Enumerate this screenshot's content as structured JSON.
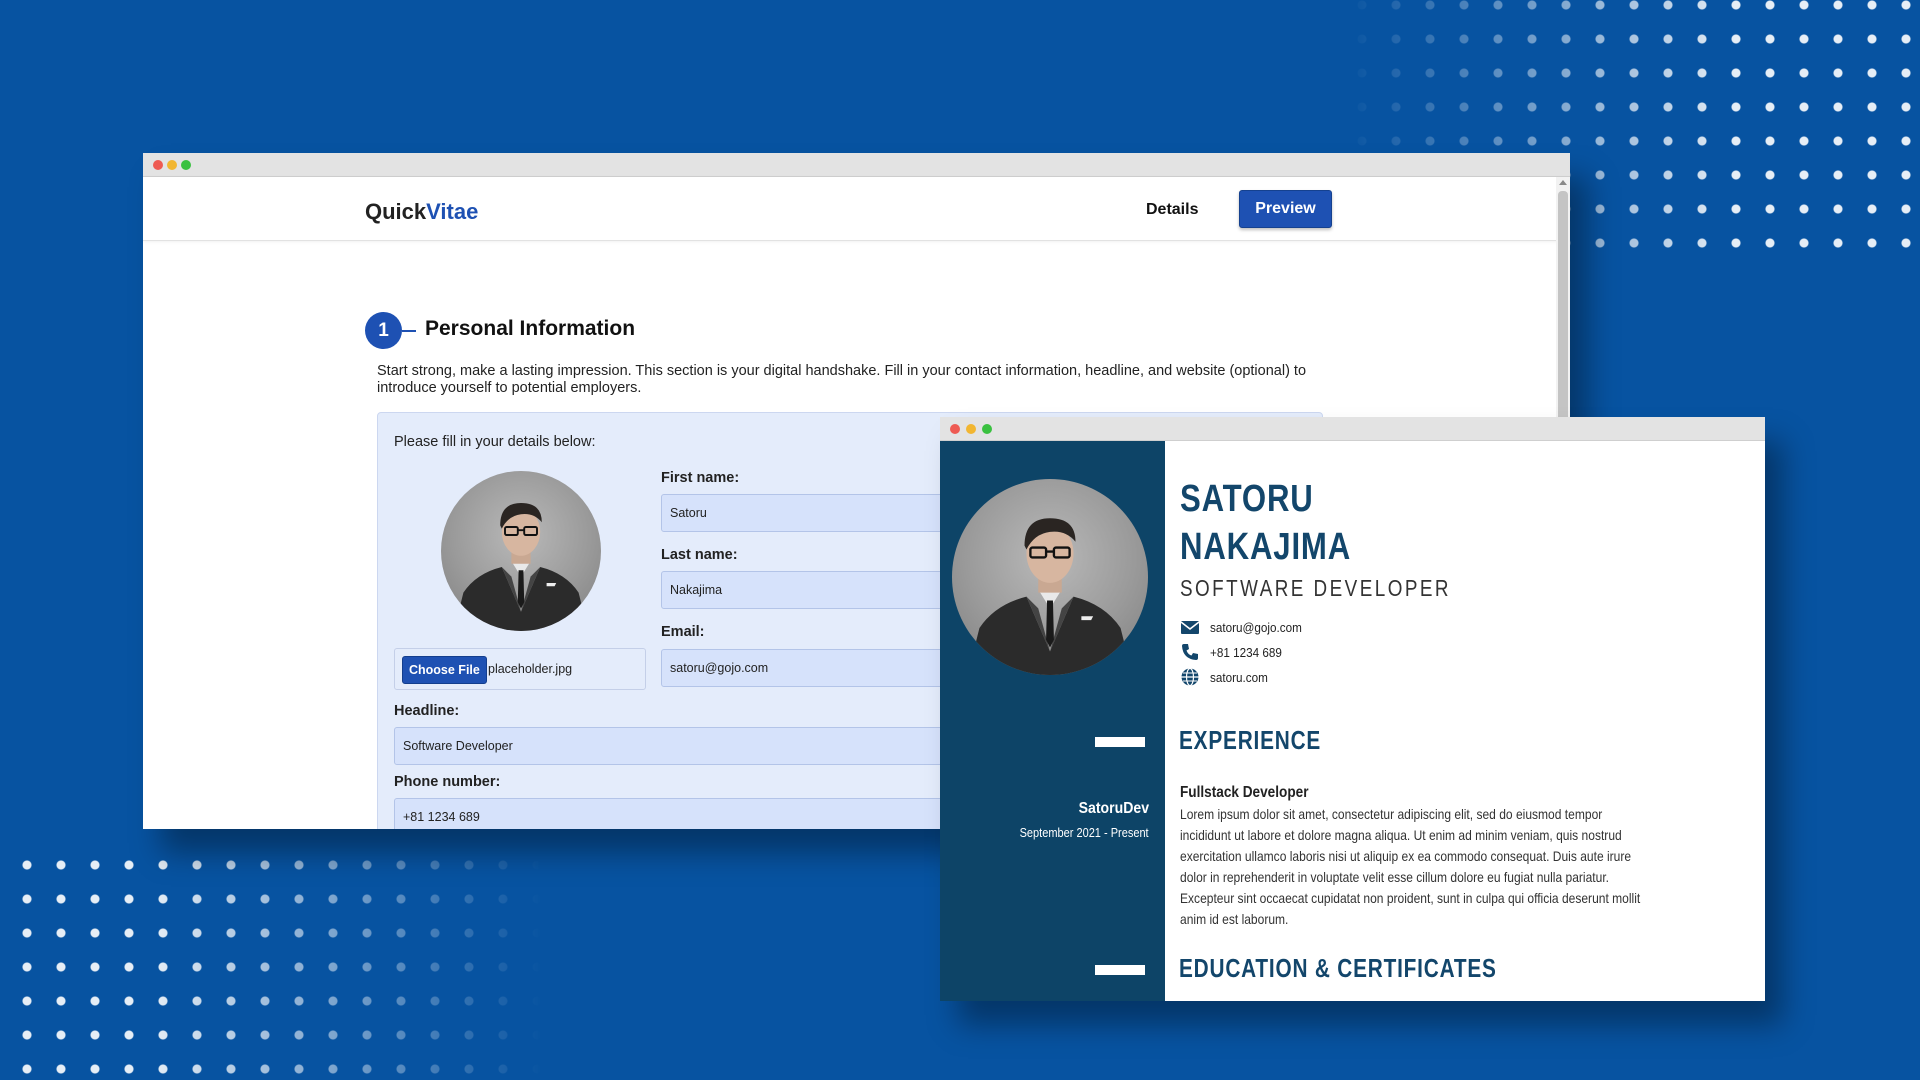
{
  "colors": {
    "background": "#0753a1",
    "brand_accent": "#1e51b3",
    "resume_sidebar": "#0d4467",
    "resume_heading": "#13466b",
    "traffic_red": "#ee5a52",
    "traffic_yellow": "#f2b631",
    "traffic_green": "#3ac140"
  },
  "editor": {
    "logo": {
      "part1": "Quick",
      "part2": "Vitae"
    },
    "nav": {
      "details": "Details",
      "preview": "Preview"
    },
    "section": {
      "number": "1",
      "title": "Personal Information",
      "intro": "Start strong, make a lasting impression. This section is your digital handshake. Fill in your contact information, headline, and website (optional) to introduce yourself to potential employers."
    },
    "form": {
      "hint": "Please fill in your details below:",
      "file_button": "Choose File",
      "file_name": "placeholder.jpg",
      "first_name": {
        "label": "First name:",
        "value": "Satoru"
      },
      "last_name": {
        "label": "Last name:",
        "value": "Nakajima"
      },
      "email": {
        "label": "Email:",
        "value": "satoru@gojo.com"
      },
      "headline": {
        "label": "Headline:",
        "value": "Software Developer"
      },
      "phone": {
        "label": "Phone number:",
        "value": "+81 1234 689"
      }
    }
  },
  "resume": {
    "first_name": "SATORU",
    "last_name": "NAKAJIMA",
    "role": "SOFTWARE DEVELOPER",
    "contacts": [
      {
        "icon": "email-icon",
        "text": "satoru@gojo.com"
      },
      {
        "icon": "phone-icon",
        "text": "+81 1234 689"
      },
      {
        "icon": "globe-icon",
        "text": "satoru.com"
      }
    ],
    "experience": {
      "title": "EXPERIENCE",
      "company": "SatoruDev",
      "dates": "September 2021 - Present",
      "job_title": "Fullstack Developer",
      "description": "Lorem ipsum dolor sit amet, consectetur adipiscing elit, sed do eiusmod tempor incididunt ut labore et dolore magna aliqua. Ut enim ad minim veniam, quis nostrud exercitation ullamco laboris nisi ut aliquip ex ea commodo consequat. Duis aute irure dolor in reprehenderit in voluptate velit esse cillum dolore eu fugiat nulla pariatur. Excepteur sint occaecat cupidatat non proident, sunt in culpa qui officia deserunt mollit anim id est laborum."
    },
    "education": {
      "title": "EDUCATION & CERTIFICATES"
    }
  }
}
